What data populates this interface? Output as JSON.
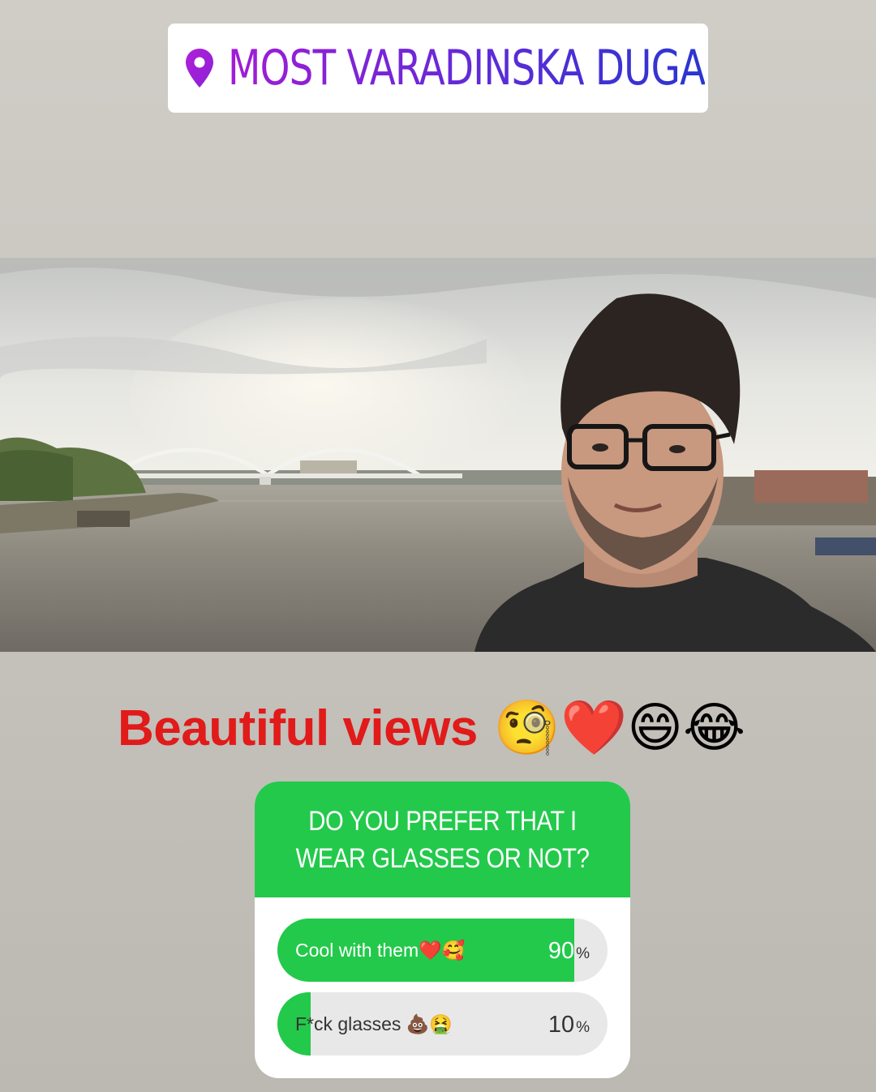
{
  "location_sticker": {
    "text": "MOST VARADINSKA DUGA",
    "icon": "location-pin-icon",
    "gradient": [
      "#a21cd6",
      "#5d2bd8",
      "#2a36cf"
    ]
  },
  "photo": {
    "subject": "selfie-photo"
  },
  "caption": {
    "text": "Beautiful views",
    "emojis": "🧐❤️😄😂",
    "color": "#e11a1a"
  },
  "poll": {
    "question": "DO YOU PREFER THAT I WEAR GLASSES OR NOT?",
    "accent": "#23c94b",
    "options": [
      {
        "label": "Cool with them❤️🥰",
        "percent_value": 90,
        "percent_number": "90",
        "percent_sign": "%"
      },
      {
        "label": "F*ck glasses 💩🤮",
        "percent_value": 10,
        "percent_number": "10",
        "percent_sign": "%"
      }
    ]
  }
}
